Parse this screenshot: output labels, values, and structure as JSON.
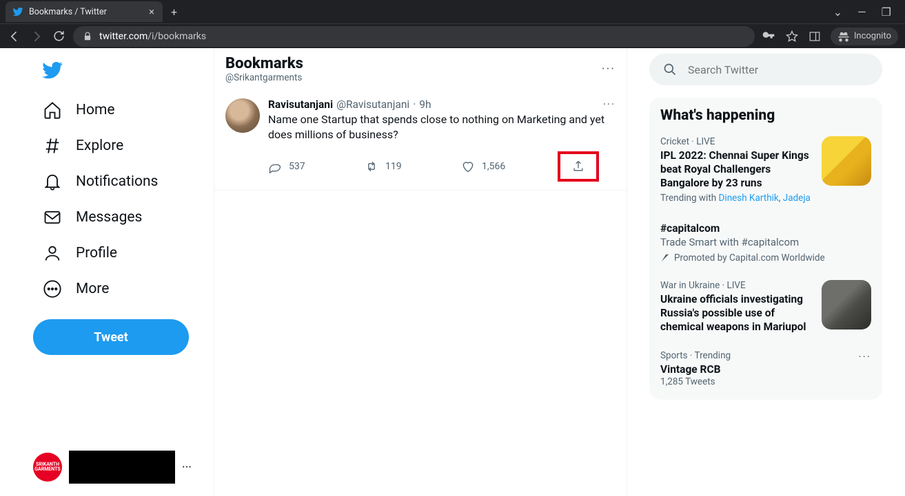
{
  "browser": {
    "tab_title": "Bookmarks / Twitter",
    "url_display_host": "twitter.com",
    "url_display_path": "/i/bookmarks",
    "incognito_label": "Incognito"
  },
  "sidebar": {
    "items": [
      {
        "label": "Home"
      },
      {
        "label": "Explore"
      },
      {
        "label": "Notifications"
      },
      {
        "label": "Messages"
      },
      {
        "label": "Profile"
      },
      {
        "label": "More"
      }
    ],
    "tweet_btn": "Tweet",
    "account_avatar_text": "SRIKANTH GARMENTS"
  },
  "header": {
    "title": "Bookmarks",
    "subtitle": "@Srikantgarments"
  },
  "tweet": {
    "author": "Ravisutanjani",
    "handle": "@Ravisutanjani",
    "time": "9h",
    "text": "Name one Startup that spends close to nothing on Marketing and yet does millions of business?",
    "replies": "537",
    "retweets": "119",
    "likes": "1,566"
  },
  "search": {
    "placeholder": "Search Twitter"
  },
  "whats": {
    "heading": "What's happening",
    "items": [
      {
        "meta": "Cricket · LIVE",
        "title": "IPL 2022: Chennai Super Kings beat Royal Challengers Bangalore by 23 runs",
        "trending_with_label": "Trending with",
        "trending_with_1": "Dinesh Karthik",
        "trending_with_2": "Jadeja",
        "has_image": true,
        "img_bg": "linear-gradient(135deg,#f7d437 0 45%,#e7b21d 45% 60%,#c98a12 100%)"
      },
      {
        "meta": "",
        "title": "#capitalcom",
        "subtitle": "Trade Smart with #capitalcom",
        "promoted": "Promoted by Capital.com Worldwide"
      },
      {
        "meta": "War in Ukraine · LIVE",
        "title": "Ukraine officials investigating Russia's possible use of chemical weapons in Mariupol",
        "has_image": true,
        "img_bg": "linear-gradient(135deg,#6e6e6a 0 40%,#4a4a46 60%,#2d2d2a 100%)"
      },
      {
        "meta": "Sports · Trending",
        "title": "Vintage RCB",
        "count": "1,285 Tweets",
        "has_more": true
      }
    ]
  }
}
